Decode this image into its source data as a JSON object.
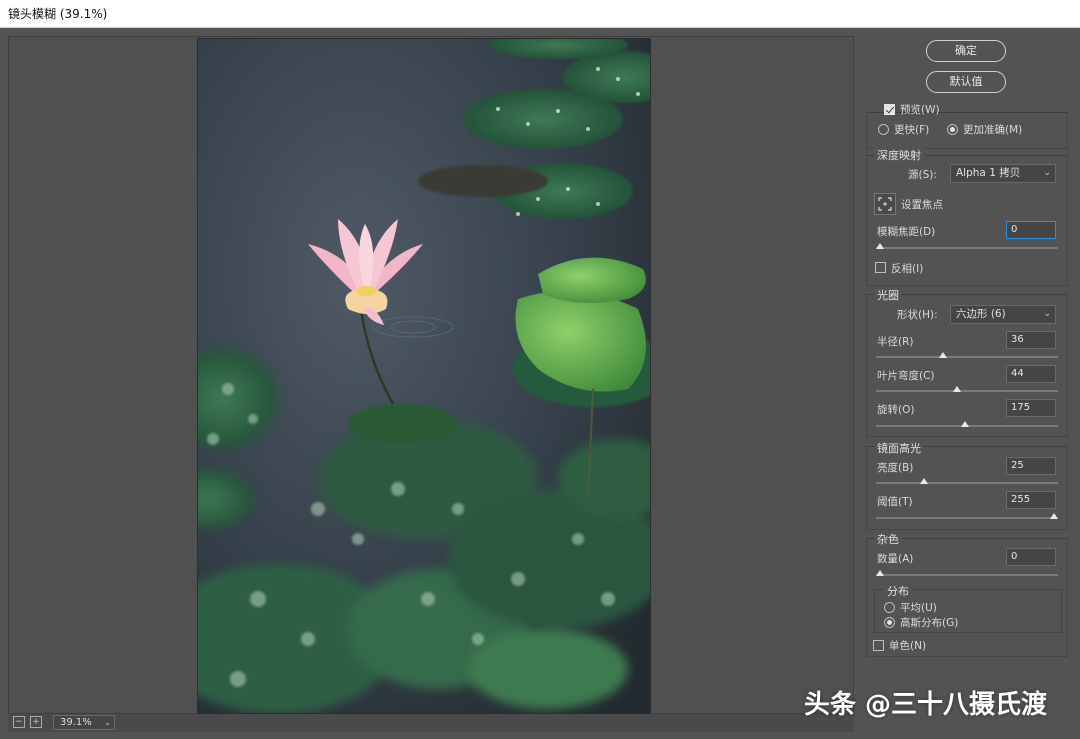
{
  "window": {
    "title": "镜头模糊 (39.1%)"
  },
  "status_bar": {
    "zoom": "39.1%",
    "zoom_out_icon": "minus-icon",
    "zoom_in_icon": "plus-icon"
  },
  "buttons": {
    "ok": "确定",
    "default": "默认值"
  },
  "preview": {
    "preview_label": "预览(W)",
    "preview_checked": true,
    "faster_label": "更快(F)",
    "accurate_label": "更加准确(M)",
    "selected": "accurate"
  },
  "depth_map": {
    "title": "深度映射",
    "source_label": "源(S):",
    "source_value": "Alpha 1 拷贝",
    "set_focus_label": "设置焦点",
    "blur_focal_label": "模糊焦距(D)",
    "blur_focal_value": "0",
    "blur_focal_level": 0,
    "invert_label": "反相(I)",
    "invert_checked": false
  },
  "iris": {
    "title": "光圈",
    "shape_label": "形状(H):",
    "shape_value": "六边形 (6)",
    "radius_label": "半径(R)",
    "radius_value": "36",
    "radius_level": 0.36,
    "blade_label": "叶片弯度(C)",
    "blade_value": "44",
    "blade_level": 0.44,
    "rotation_label": "旋转(O)",
    "rotation_value": "175",
    "rotation_level": 0.49
  },
  "specular": {
    "title": "镜面高光",
    "brightness_label": "亮度(B)",
    "brightness_value": "25",
    "brightness_level": 0.25,
    "threshold_label": "阈值(T)",
    "threshold_value": "255",
    "threshold_level": 1.0
  },
  "noise": {
    "title": "杂色",
    "amount_label": "数量(A)",
    "amount_value": "0",
    "amount_level": 0,
    "distribution_title": "分布",
    "uniform_label": "平均(U)",
    "gaussian_label": "高斯分布(G)",
    "selected": "gaussian",
    "mono_label": "单色(N)",
    "mono_checked": false
  },
  "watermark": "头条 @三十八摄氏渡"
}
